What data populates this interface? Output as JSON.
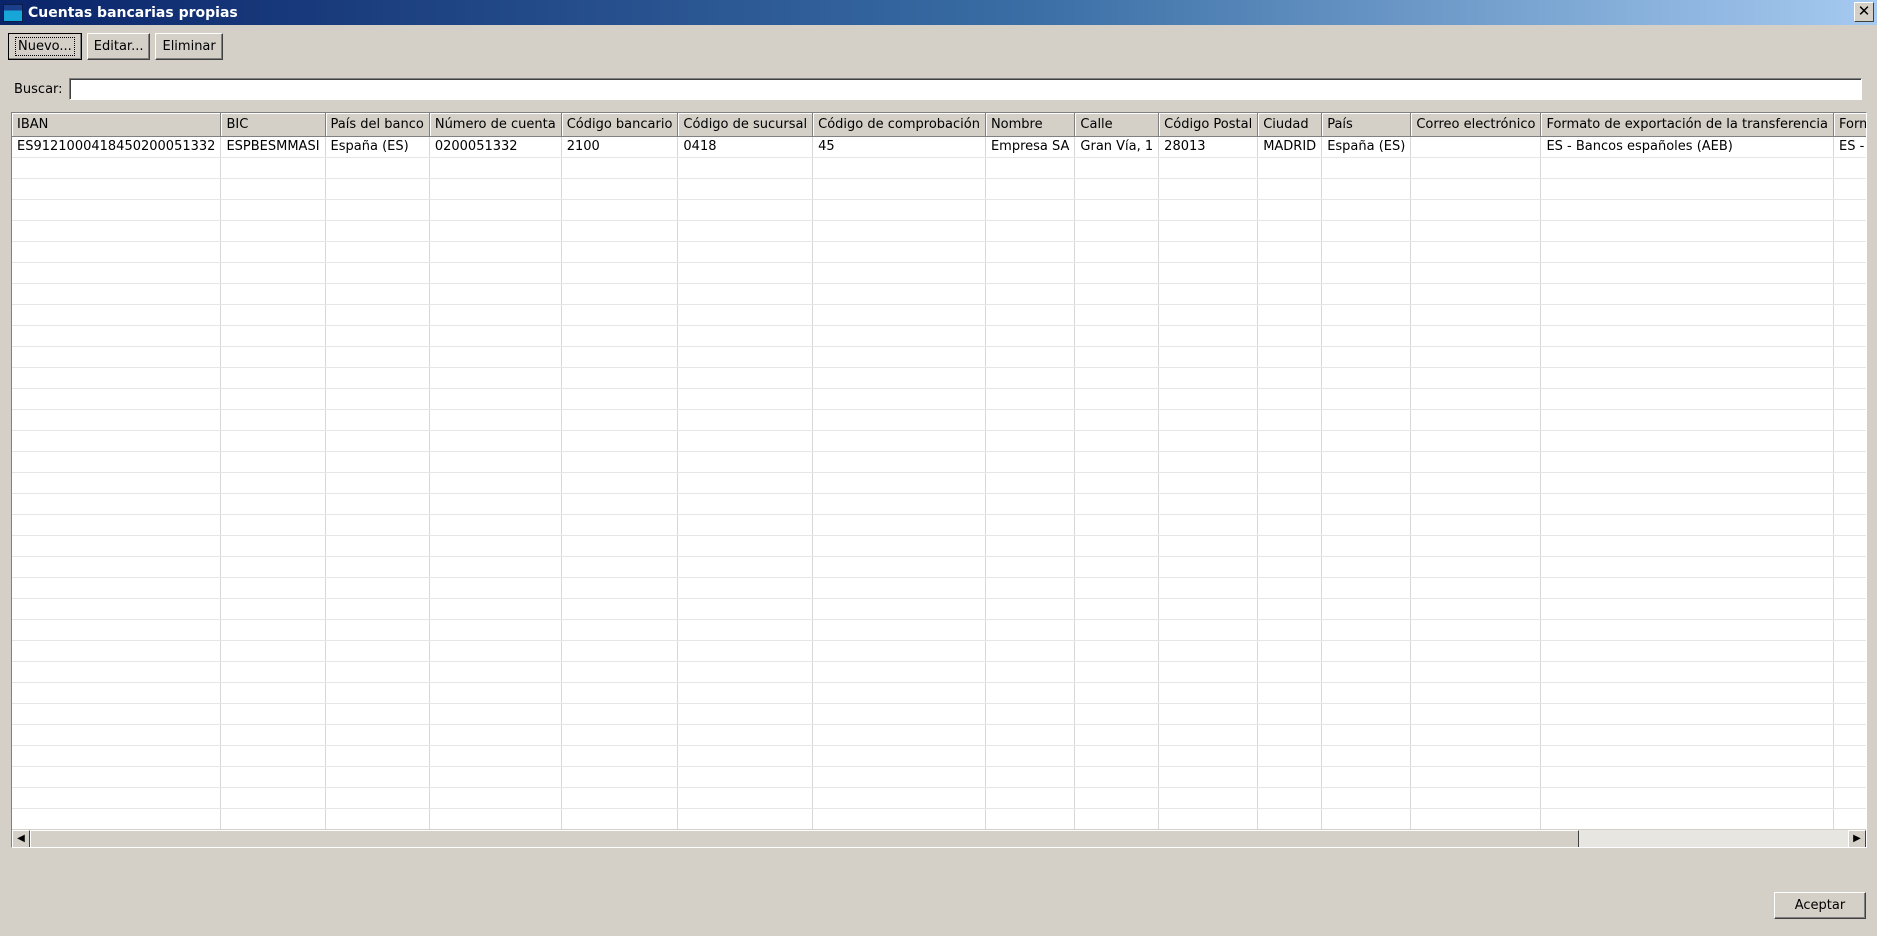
{
  "window": {
    "title": "Cuentas bancarias propias",
    "close_symbol": "✕"
  },
  "toolbar": {
    "new_label": "Nuevo...",
    "edit_label": "Editar...",
    "delete_label": "Eliminar"
  },
  "search": {
    "label": "Buscar:",
    "value": "",
    "placeholder": ""
  },
  "table": {
    "columns": [
      "IBAN",
      "BIC",
      "País del banco",
      "Número de cuenta",
      "Código bancario",
      "Código de sucursal",
      "Código de comprobación",
      "Nombre",
      "Calle",
      "Código Postal",
      "Ciudad",
      "País",
      "Correo electrónico",
      "Formato de exportación de la transferencia",
      "Formato de expor"
    ],
    "rows": [
      [
        "ES9121000418450200051332",
        "ESPBESMMASI",
        "España (ES)",
        "0200051332",
        "2100",
        "0418",
        "45",
        "Empresa SA",
        "Gran Vía, 1",
        "28013",
        "MADRID",
        "España (ES)",
        "",
        "ES - Bancos españoles (AEB)",
        "ES - Bancos españ"
      ]
    ]
  },
  "scrollbar": {
    "left_arrow": "◀",
    "right_arrow": "▶"
  },
  "footer": {
    "ok_label": "Aceptar"
  }
}
